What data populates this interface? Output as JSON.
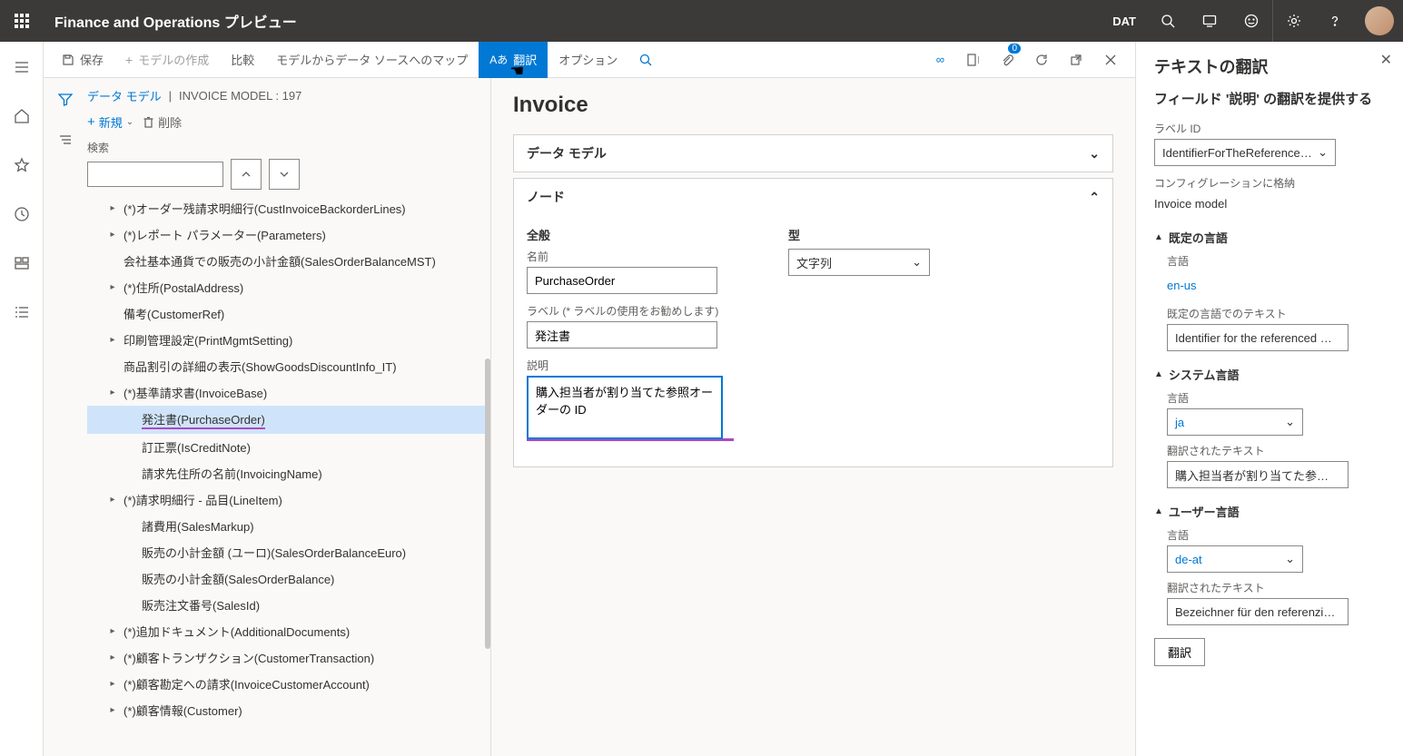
{
  "header": {
    "title": "Finance and Operations プレビュー",
    "company": "DAT"
  },
  "toolbar": {
    "save": "保存",
    "create_model": "モデルの作成",
    "compare": "比較",
    "map_source": "モデルからデータ ソースへのマップ",
    "translate": "翻訳",
    "option": "オプション",
    "badge_count": "0"
  },
  "breadcrumb": {
    "root": "データ モデル",
    "current": "INVOICE MODEL : 197"
  },
  "tree_ops": {
    "new": "新規",
    "delete": "削除"
  },
  "search_label": "検索",
  "tree_items": [
    {
      "label": "(*)オーダー残請求明細行(CustInvoiceBackorderLines)",
      "expand": true
    },
    {
      "label": "(*)レポート パラメーター(Parameters)",
      "expand": true
    },
    {
      "label": "会社基本通貨での販売の小計金額(SalesOrderBalanceMST)",
      "expand": false
    },
    {
      "label": "(*)住所(PostalAddress)",
      "expand": true
    },
    {
      "label": "備考(CustomerRef)",
      "expand": false
    },
    {
      "label": "印刷管理設定(PrintMgmtSetting)",
      "expand": true
    },
    {
      "label": "商品割引の詳細の表示(ShowGoodsDiscountInfo_IT)",
      "expand": false
    },
    {
      "label": "(*)基準請求書(InvoiceBase)",
      "expand": true
    },
    {
      "label": "発注書(PurchaseOrder)",
      "expand": false,
      "selected": true,
      "child": true,
      "underline": true
    },
    {
      "label": "訂正票(IsCreditNote)",
      "expand": false,
      "child": true
    },
    {
      "label": "請求先住所の名前(InvoicingName)",
      "expand": false,
      "child": true
    },
    {
      "label": "(*)請求明細行 - 品目(LineItem)",
      "expand": true
    },
    {
      "label": "諸費用(SalesMarkup)",
      "expand": false,
      "child": true
    },
    {
      "label": "販売の小計金額 (ユーロ)(SalesOrderBalanceEuro)",
      "expand": false,
      "child": true
    },
    {
      "label": "販売の小計金額(SalesOrderBalance)",
      "expand": false,
      "child": true
    },
    {
      "label": "販売注文番号(SalesId)",
      "expand": false,
      "child": true
    },
    {
      "label": "(*)追加ドキュメント(AdditionalDocuments)",
      "expand": true
    },
    {
      "label": "(*)顧客トランザクション(CustomerTransaction)",
      "expand": true
    },
    {
      "label": "(*)顧客勘定への請求(InvoiceCustomerAccount)",
      "expand": true
    },
    {
      "label": "(*)顧客情報(Customer)",
      "expand": true
    }
  ],
  "detail": {
    "title": "Invoice",
    "panel_data_model": "データ モデル",
    "panel_node": "ノード",
    "section_general": "全般",
    "section_type": "型",
    "label_name": "名前",
    "value_name": "PurchaseOrder",
    "label_label": "ラベル (* ラベルの使用をお勧めします)",
    "value_label": "発注書",
    "label_desc": "説明",
    "value_desc": "購入担当者が割り当てた参照オーダーの ID",
    "value_type": "文字列"
  },
  "side": {
    "title": "テキストの翻訳",
    "subtitle": "フィールド '説明' の翻訳を提供する",
    "label_id_label": "ラベル ID",
    "label_id_value": "IdentifierForTheReferencedOr...",
    "config_label": "コンフィグレーションに格納",
    "config_value": "Invoice model",
    "sec_default": "既定の言語",
    "lang_label": "言語",
    "default_lang": "en-us",
    "default_text_label": "既定の言語でのテキスト",
    "default_text_value": "Identifier for the referenced Or...",
    "sec_system": "システム言語",
    "system_lang": "ja",
    "translated_label": "翻訳されたテキスト",
    "system_text": "購入担当者が割り当てた参照オ...",
    "sec_user": "ユーザー言語",
    "user_lang": "de-at",
    "user_text": "Bezeichner für den referenzierte...",
    "translate_btn": "翻訳"
  }
}
